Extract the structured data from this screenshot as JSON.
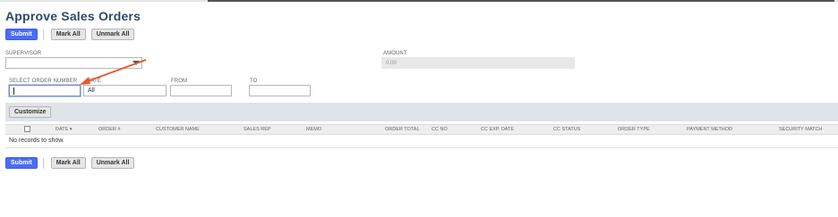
{
  "page": {
    "title": "Approve Sales Orders"
  },
  "toolbar": {
    "submit_label": "Submit",
    "mark_all_label": "Mark All",
    "unmark_all_label": "Unmark All"
  },
  "filters": {
    "supervisor": {
      "label": "SUPERVISOR",
      "value": ""
    },
    "amount": {
      "label": "AMOUNT",
      "value": "0.00"
    },
    "select_order_number": {
      "label": "SELECT ORDER NUMBER",
      "value": ""
    },
    "date": {
      "label": "DATE",
      "value": "All"
    },
    "from": {
      "label": "FROM",
      "value": ""
    },
    "to": {
      "label": "TO",
      "value": ""
    }
  },
  "sublist": {
    "customize_label": "Customize",
    "columns": [
      "DATE ▾",
      "ORDER #",
      "CUSTOMER NAME",
      "SALES REP",
      "MEMO",
      "ORDER TOTAL",
      "CC NO",
      "CC EXP. DATE",
      "CC STATUS",
      "ORDER TYPE",
      "PAYMENT METHOD",
      "SECURITY MATCH"
    ],
    "empty_text": "No records to show."
  },
  "colors": {
    "accent": "#4a6cf7",
    "title": "#2e4a6b",
    "annotation_arrow": "#e8582c"
  }
}
